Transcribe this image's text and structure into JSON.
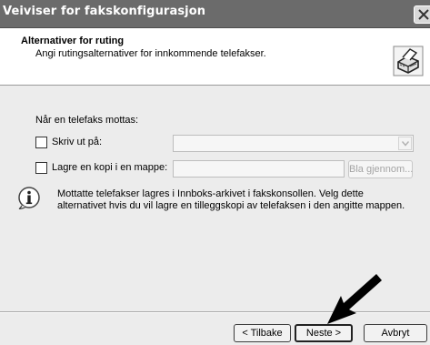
{
  "window": {
    "title": "Veiviser for fakskonfigurasjon"
  },
  "header": {
    "title": "Alternativer for ruting",
    "subtitle": "Angi rutingsalternativer for innkommende telefakser.",
    "icon": "fax-machine-icon"
  },
  "form": {
    "section_label": "Når en telefaks mottas:",
    "print_label": "Skriv ut på:",
    "print_checked": false,
    "print_select_value": "",
    "copy_label": "Lagre en kopi i en mappe:",
    "copy_checked": false,
    "copy_folder_value": "",
    "browse_label": "Bla gjennom..."
  },
  "info": {
    "icon": "info-icon",
    "text": "Mottatte telefakser lagres i Innboks-arkivet i fakskonsollen. Velg dette alternativet hvis du vil lagre en tilleggskopi av telefaksen i den angitte mappen."
  },
  "footer": {
    "back_label": "< Tilbake",
    "next_label": "Neste >",
    "cancel_label": "Avbryt"
  },
  "colors": {
    "titlebar": "#6b6b6b",
    "dialog_bg": "#ececec",
    "header_bg": "#ffffff",
    "pointer_arrow": "#000000"
  }
}
